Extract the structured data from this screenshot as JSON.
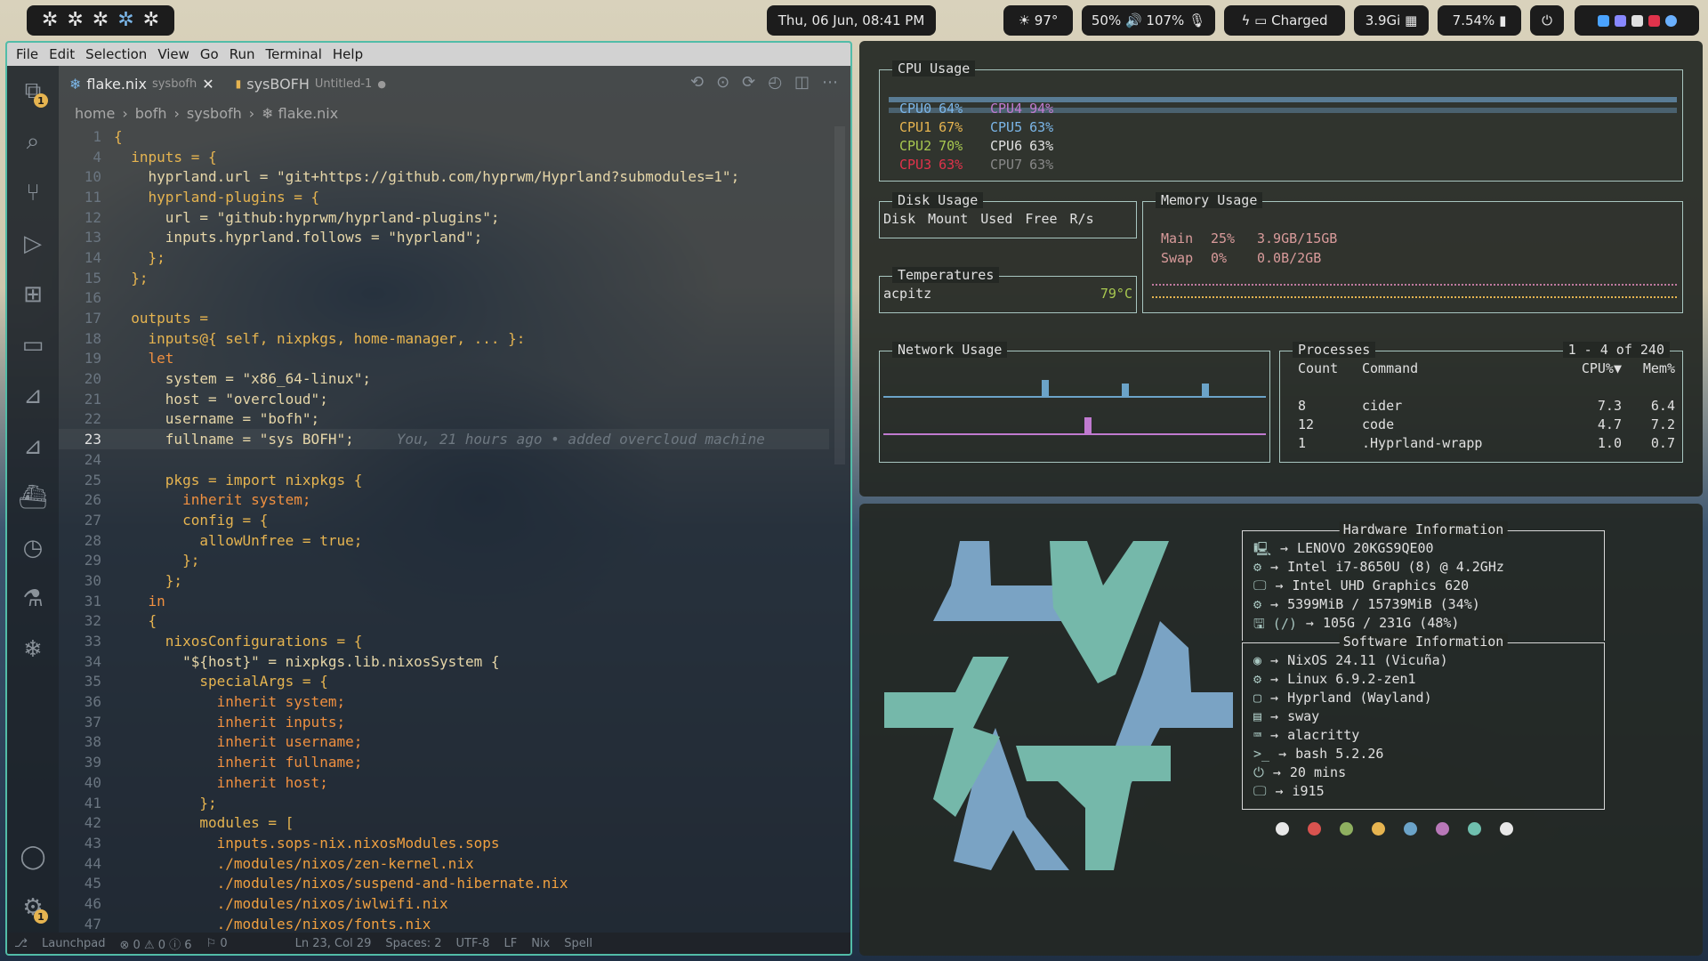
{
  "topbar": {
    "datetime": "Thu, 06 Jun, 08:41 PM",
    "weather": "☀ 97°",
    "audio": "50% 🔊 107% 🎙",
    "battery": "ϟ ▭ Charged",
    "memory": "3.9Gi ▦",
    "cpu": "7.54% ▮",
    "power_icon": "⏻",
    "workspace_icon": "✲",
    "tray_colors": [
      "#4aa3ff",
      "#8888ff",
      "#e0e0e0",
      "#e0334b",
      "#6ab0ff"
    ]
  },
  "editor": {
    "menu": [
      "File",
      "Edit",
      "Selection",
      "View",
      "Go",
      "Run",
      "Terminal",
      "Help"
    ],
    "explorer_badge": "1",
    "settings_badge": "1",
    "tabs": [
      {
        "name": "flake.nix",
        "folder": "sysbofh",
        "close": "✕"
      },
      {
        "name": "sysBOFH",
        "folder": "Untitled-1",
        "close": "●"
      }
    ],
    "breadcrumb": [
      "home",
      "›",
      "bofh",
      "›",
      "sysbofh",
      "›",
      "❄ flake.nix"
    ],
    "code": [
      {
        "n": "1",
        "t": "{"
      },
      {
        "n": "4",
        "t": "  inputs = {"
      },
      {
        "n": "10",
        "t": "    hyprland.url = \"git+https://github.com/hyprwm/Hyprland?submodules=1\";"
      },
      {
        "n": "11",
        "t": "    hyprland-plugins = {"
      },
      {
        "n": "12",
        "t": "      url = \"github:hyprwm/hyprland-plugins\";"
      },
      {
        "n": "13",
        "t": "      inputs.hyprland.follows = \"hyprland\";"
      },
      {
        "n": "14",
        "t": "    };"
      },
      {
        "n": "15",
        "t": "  };"
      },
      {
        "n": "16",
        "t": ""
      },
      {
        "n": "17",
        "t": "  outputs ="
      },
      {
        "n": "18",
        "t": "    inputs@{ self, nixpkgs, home-manager, ... }:"
      },
      {
        "n": "19",
        "t": "    let"
      },
      {
        "n": "20",
        "t": "      system = \"x86_64-linux\";"
      },
      {
        "n": "21",
        "t": "      host = \"overcloud\";"
      },
      {
        "n": "22",
        "t": "      username = \"bofh\";"
      },
      {
        "n": "23",
        "t": "      fullname = \"sys BOFH\";"
      },
      {
        "n": "24",
        "t": ""
      },
      {
        "n": "25",
        "t": "      pkgs = import nixpkgs {"
      },
      {
        "n": "26",
        "t": "        inherit system;"
      },
      {
        "n": "27",
        "t": "        config = {"
      },
      {
        "n": "28",
        "t": "          allowUnfree = true;"
      },
      {
        "n": "29",
        "t": "        };"
      },
      {
        "n": "30",
        "t": "      };"
      },
      {
        "n": "31",
        "t": "    in"
      },
      {
        "n": "32",
        "t": "    {"
      },
      {
        "n": "33",
        "t": "      nixosConfigurations = {"
      },
      {
        "n": "34",
        "t": "        \"${host}\" = nixpkgs.lib.nixosSystem {"
      },
      {
        "n": "35",
        "t": "          specialArgs = {"
      },
      {
        "n": "36",
        "t": "            inherit system;"
      },
      {
        "n": "37",
        "t": "            inherit inputs;"
      },
      {
        "n": "38",
        "t": "            inherit username;"
      },
      {
        "n": "39",
        "t": "            inherit fullname;"
      },
      {
        "n": "40",
        "t": "            inherit host;"
      },
      {
        "n": "41",
        "t": "          };"
      },
      {
        "n": "42",
        "t": "          modules = ["
      },
      {
        "n": "43",
        "t": "            inputs.sops-nix.nixosModules.sops"
      },
      {
        "n": "44",
        "t": "            ./modules/nixos/zen-kernel.nix"
      },
      {
        "n": "45",
        "t": "            ./modules/nixos/suspend-and-hibernate.nix"
      },
      {
        "n": "46",
        "t": "            ./modules/nixos/iwlwifi.nix"
      },
      {
        "n": "47",
        "t": "            ./modules/nixos/fonts.nix"
      }
    ],
    "blame": "You, 21 hours ago • added overcloud machine",
    "status": [
      "⎇",
      "Launchpad",
      "⊗ 0 ⚠ 0 ⓘ 6",
      "⚐ 0",
      "Ln 23, Col 29",
      "Spaces: 2",
      "UTF-8",
      "LF",
      "Nix",
      "Spell"
    ]
  },
  "btop": {
    "cpu_title": "CPU Usage",
    "cpus": [
      {
        "label": "CPU0",
        "val": "64%",
        "color": "#7bb6e8"
      },
      {
        "label": "CPU4",
        "val": "94%",
        "color": "#c07ad0"
      },
      {
        "label": "CPU1",
        "val": "67%",
        "color": "#e6b450"
      },
      {
        "label": "CPU5",
        "val": "63%",
        "color": "#7bb6e8"
      },
      {
        "label": "CPU2",
        "val": "70%",
        "color": "#a8c850"
      },
      {
        "label": "CPU6",
        "val": "63%",
        "color": "#e0e0e0"
      },
      {
        "label": "CPU3",
        "val": "63%",
        "color": "#e0334b"
      },
      {
        "label": "CPU7",
        "val": "63%",
        "color": "#888888"
      }
    ],
    "disk_title": "Disk Usage",
    "disk_headers": [
      "Disk",
      "Mount",
      "Used",
      "Free",
      "R/s"
    ],
    "mem_title": "Memory Usage",
    "mem_rows": [
      {
        "name": "Main",
        "pct": "25%",
        "val": "3.9GB/15GB"
      },
      {
        "name": "Swap",
        "pct": "0%",
        "val": "0.0B/2GB"
      }
    ],
    "temp_title": "Temperatures",
    "temp_name": "acpitz",
    "temp_val": "79°C",
    "net_title": "Network Usage",
    "proc_title": "Processes",
    "proc_range": "1 - 4 of 240",
    "proc_headers": [
      "Count",
      "Command",
      "CPU%▼",
      "Mem%"
    ],
    "procs": [
      {
        "count": "8",
        "cmd": "cider",
        "cpu": "7.3",
        "mem": "6.4"
      },
      {
        "count": "12",
        "cmd": "code",
        "cpu": "4.7",
        "mem": "7.2"
      },
      {
        "count": "1",
        "cmd": ".Hyprland-wrapp",
        "cpu": "1.0",
        "mem": "0.7"
      }
    ]
  },
  "fetch": {
    "hw_title": "Hardware Information",
    "hw": [
      {
        "icon": "🖳",
        "val": "LENOVO 20KGS9QE00"
      },
      {
        "icon": "⚙",
        "val": "Intel i7-8650U (8) @ 4.2GHz"
      },
      {
        "icon": "🖵",
        "val": "Intel UHD Graphics 620"
      },
      {
        "icon": "⚙",
        "val": "5399MiB / 15739MiB (34%)"
      },
      {
        "icon": "🖫 (/)",
        "val": "105G / 231G (48%)"
      }
    ],
    "sw_title": "Software Information",
    "sw": [
      {
        "icon": "◉",
        "val": "NixOS 24.11 (Vicuña)"
      },
      {
        "icon": "⚙",
        "val": "Linux 6.9.2-zen1"
      },
      {
        "icon": "▢",
        "val": "Hyprland (Wayland)"
      },
      {
        "icon": "▤",
        "val": "sway"
      },
      {
        "icon": "⌨",
        "val": "alacritty"
      },
      {
        "icon": ">_",
        "val": "bash 5.2.26"
      },
      {
        "icon": "⏻",
        "val": "20 mins"
      },
      {
        "icon": "🖵",
        "val": "i915"
      }
    ],
    "arrow": "→",
    "palette": [
      "#e8e8e8",
      "#d9534f",
      "#8fb060",
      "#e6b450",
      "#6ba3c8",
      "#b878b8",
      "#6fbfae",
      "#e8e8e8"
    ]
  }
}
